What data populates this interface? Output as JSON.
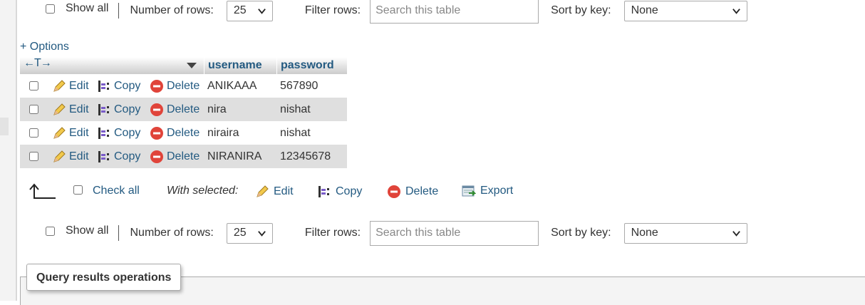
{
  "nav_top": {
    "show_all": "Show all",
    "rows_label": "Number of rows:",
    "rows_value": "25",
    "filter_label": "Filter rows:",
    "search_placeholder": "Search this table",
    "sort_label": "Sort by key:",
    "sort_value": "None"
  },
  "nav_bottom": {
    "show_all": "Show all",
    "rows_label": "Number of rows:",
    "rows_value": "25",
    "filter_label": "Filter rows:",
    "search_placeholder": "Search this table",
    "sort_label": "Sort by key:",
    "sort_value": "None"
  },
  "options_label": "+ Options",
  "table": {
    "arrows_glyph": "←T→",
    "columns": [
      "username",
      "password"
    ],
    "actions": {
      "edit": "Edit",
      "copy": "Copy",
      "delete": "Delete"
    },
    "rows": [
      {
        "username": "ANIKAAA",
        "password": "567890"
      },
      {
        "username": "nira",
        "password": "nishat"
      },
      {
        "username": "niraira",
        "password": "nishat"
      },
      {
        "username": "NIRANIRA",
        "password": "12345678"
      }
    ]
  },
  "bulk": {
    "check_all": "Check all",
    "with_selected": "With selected:",
    "edit": "Edit",
    "copy": "Copy",
    "delete": "Delete",
    "export": "Export"
  },
  "query_ops": {
    "title": "Query results operations"
  },
  "colors": {
    "link": "#235a81",
    "row_alt": "#dfdfdf",
    "delete_red": "#e0443a"
  },
  "icons": [
    "pencil-icon",
    "copy-icon",
    "delete-icon",
    "export-icon",
    "chevron-down-icon",
    "sort-triangle-icon",
    "corner-arrow-icon"
  ]
}
